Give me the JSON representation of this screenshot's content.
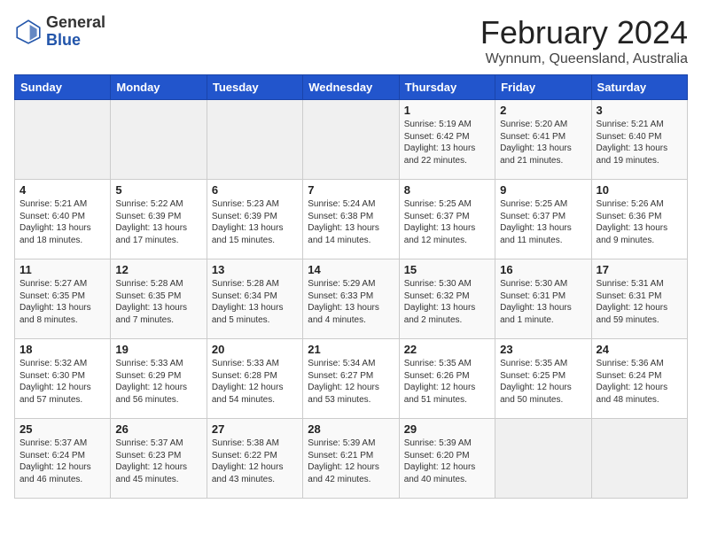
{
  "header": {
    "logo_general": "General",
    "logo_blue": "Blue",
    "month_title": "February 2024",
    "subtitle": "Wynnum, Queensland, Australia"
  },
  "days_of_week": [
    "Sunday",
    "Monday",
    "Tuesday",
    "Wednesday",
    "Thursday",
    "Friday",
    "Saturday"
  ],
  "weeks": [
    [
      {
        "day": "",
        "info": ""
      },
      {
        "day": "",
        "info": ""
      },
      {
        "day": "",
        "info": ""
      },
      {
        "day": "",
        "info": ""
      },
      {
        "day": "1",
        "info": "Sunrise: 5:19 AM\nSunset: 6:42 PM\nDaylight: 13 hours\nand 22 minutes."
      },
      {
        "day": "2",
        "info": "Sunrise: 5:20 AM\nSunset: 6:41 PM\nDaylight: 13 hours\nand 21 minutes."
      },
      {
        "day": "3",
        "info": "Sunrise: 5:21 AM\nSunset: 6:40 PM\nDaylight: 13 hours\nand 19 minutes."
      }
    ],
    [
      {
        "day": "4",
        "info": "Sunrise: 5:21 AM\nSunset: 6:40 PM\nDaylight: 13 hours\nand 18 minutes."
      },
      {
        "day": "5",
        "info": "Sunrise: 5:22 AM\nSunset: 6:39 PM\nDaylight: 13 hours\nand 17 minutes."
      },
      {
        "day": "6",
        "info": "Sunrise: 5:23 AM\nSunset: 6:39 PM\nDaylight: 13 hours\nand 15 minutes."
      },
      {
        "day": "7",
        "info": "Sunrise: 5:24 AM\nSunset: 6:38 PM\nDaylight: 13 hours\nand 14 minutes."
      },
      {
        "day": "8",
        "info": "Sunrise: 5:25 AM\nSunset: 6:37 PM\nDaylight: 13 hours\nand 12 minutes."
      },
      {
        "day": "9",
        "info": "Sunrise: 5:25 AM\nSunset: 6:37 PM\nDaylight: 13 hours\nand 11 minutes."
      },
      {
        "day": "10",
        "info": "Sunrise: 5:26 AM\nSunset: 6:36 PM\nDaylight: 13 hours\nand 9 minutes."
      }
    ],
    [
      {
        "day": "11",
        "info": "Sunrise: 5:27 AM\nSunset: 6:35 PM\nDaylight: 13 hours\nand 8 minutes."
      },
      {
        "day": "12",
        "info": "Sunrise: 5:28 AM\nSunset: 6:35 PM\nDaylight: 13 hours\nand 7 minutes."
      },
      {
        "day": "13",
        "info": "Sunrise: 5:28 AM\nSunset: 6:34 PM\nDaylight: 13 hours\nand 5 minutes."
      },
      {
        "day": "14",
        "info": "Sunrise: 5:29 AM\nSunset: 6:33 PM\nDaylight: 13 hours\nand 4 minutes."
      },
      {
        "day": "15",
        "info": "Sunrise: 5:30 AM\nSunset: 6:32 PM\nDaylight: 13 hours\nand 2 minutes."
      },
      {
        "day": "16",
        "info": "Sunrise: 5:30 AM\nSunset: 6:31 PM\nDaylight: 13 hours\nand 1 minute."
      },
      {
        "day": "17",
        "info": "Sunrise: 5:31 AM\nSunset: 6:31 PM\nDaylight: 12 hours\nand 59 minutes."
      }
    ],
    [
      {
        "day": "18",
        "info": "Sunrise: 5:32 AM\nSunset: 6:30 PM\nDaylight: 12 hours\nand 57 minutes."
      },
      {
        "day": "19",
        "info": "Sunrise: 5:33 AM\nSunset: 6:29 PM\nDaylight: 12 hours\nand 56 minutes."
      },
      {
        "day": "20",
        "info": "Sunrise: 5:33 AM\nSunset: 6:28 PM\nDaylight: 12 hours\nand 54 minutes."
      },
      {
        "day": "21",
        "info": "Sunrise: 5:34 AM\nSunset: 6:27 PM\nDaylight: 12 hours\nand 53 minutes."
      },
      {
        "day": "22",
        "info": "Sunrise: 5:35 AM\nSunset: 6:26 PM\nDaylight: 12 hours\nand 51 minutes."
      },
      {
        "day": "23",
        "info": "Sunrise: 5:35 AM\nSunset: 6:25 PM\nDaylight: 12 hours\nand 50 minutes."
      },
      {
        "day": "24",
        "info": "Sunrise: 5:36 AM\nSunset: 6:24 PM\nDaylight: 12 hours\nand 48 minutes."
      }
    ],
    [
      {
        "day": "25",
        "info": "Sunrise: 5:37 AM\nSunset: 6:24 PM\nDaylight: 12 hours\nand 46 minutes."
      },
      {
        "day": "26",
        "info": "Sunrise: 5:37 AM\nSunset: 6:23 PM\nDaylight: 12 hours\nand 45 minutes."
      },
      {
        "day": "27",
        "info": "Sunrise: 5:38 AM\nSunset: 6:22 PM\nDaylight: 12 hours\nand 43 minutes."
      },
      {
        "day": "28",
        "info": "Sunrise: 5:39 AM\nSunset: 6:21 PM\nDaylight: 12 hours\nand 42 minutes."
      },
      {
        "day": "29",
        "info": "Sunrise: 5:39 AM\nSunset: 6:20 PM\nDaylight: 12 hours\nand 40 minutes."
      },
      {
        "day": "",
        "info": ""
      },
      {
        "day": "",
        "info": ""
      }
    ]
  ]
}
